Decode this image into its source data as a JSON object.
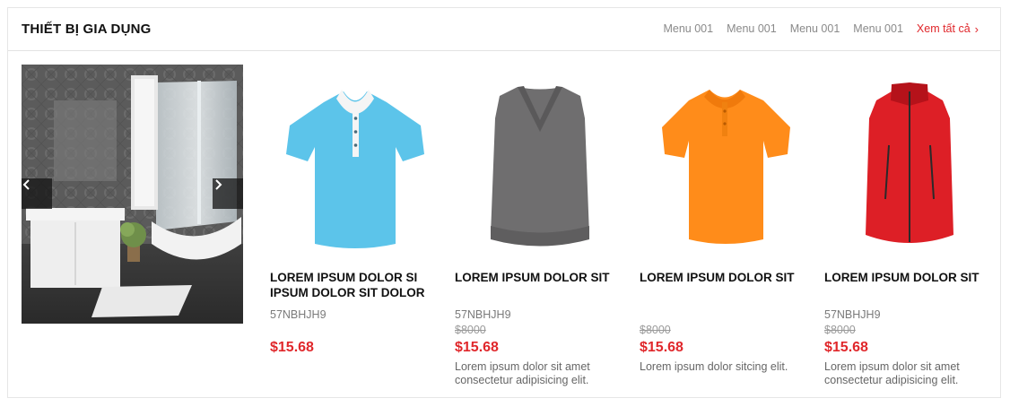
{
  "section": {
    "title": "THIẾT BỊ GIA DỤNG",
    "menu": [
      "Menu 001",
      "Menu 001",
      "Menu 001",
      "Menu 001"
    ],
    "view_all": "Xem tất cả",
    "view_all_icon": "chevron-right-icon"
  },
  "banner": {
    "prev_icon": "chevron-left-icon",
    "next_icon": "chevron-right-icon",
    "prev_glyph": "‹",
    "next_glyph": "›"
  },
  "products": [
    {
      "name": "LOREM IPSUM DOLOR SI IPSUM DOLOR SIT DOLOR",
      "sku": "57NBHJH9",
      "old_price": "",
      "price": "$15.68",
      "desc": "",
      "shirt_color": "#5cc4ea",
      "image": "light-blue-polo-shirt"
    },
    {
      "name": "LOREM IPSUM DOLOR SIT",
      "sku": "57NBHJH9",
      "old_price": "$8000",
      "price": "$15.68",
      "desc": "Lorem ipsum dolor sit amet consectetur adipisicing elit.",
      "shirt_color": "#6f6e6f",
      "image": "grey-sweater-vest"
    },
    {
      "name": "LOREM IPSUM DOLOR SIT",
      "sku": "",
      "old_price": "$8000",
      "price": "$15.68",
      "desc": "Lorem ipsum dolor sitcing elit.",
      "shirt_color": "#ff8c1a",
      "image": "orange-polo-shirt"
    },
    {
      "name": "LOREM IPSUM DOLOR SIT",
      "sku": "57NBHJH9",
      "old_price": "$8000",
      "price": "$15.68",
      "desc": "Lorem ipsum dolor sit amet consectetur adipisicing elit.",
      "shirt_color": "#dd1f26",
      "image": "red-softshell-vest"
    }
  ],
  "colors": {
    "accent": "#e0272b",
    "menu_text": "#8a8a8a"
  }
}
